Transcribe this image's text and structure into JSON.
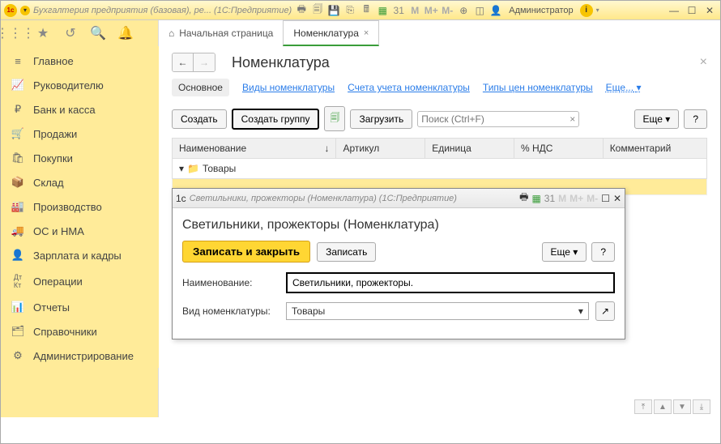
{
  "titlebar": {
    "title": "Бухгалтерия предприятия (базовая), ре... (1С:Предприятие)",
    "user_label": "Администратор",
    "m": "M",
    "mplus": "M+",
    "mminus": "M-"
  },
  "tabs": {
    "home": "Начальная страница",
    "active": "Номенклатура"
  },
  "sidebar": {
    "items": [
      {
        "label": "Главное"
      },
      {
        "label": "Руководителю"
      },
      {
        "label": "Банк и касса"
      },
      {
        "label": "Продажи"
      },
      {
        "label": "Покупки"
      },
      {
        "label": "Склад"
      },
      {
        "label": "Производство"
      },
      {
        "label": "ОС и НМА"
      },
      {
        "label": "Зарплата и кадры"
      },
      {
        "label": "Операции"
      },
      {
        "label": "Отчеты"
      },
      {
        "label": "Справочники"
      },
      {
        "label": "Администрирование"
      }
    ]
  },
  "page": {
    "title": "Номенклатура",
    "subtabs": {
      "main": "Основное",
      "types": "Виды номенклатуры",
      "accounts": "Счета учета номенклатуры",
      "price_types": "Типы цен номенклатуры",
      "more": "Еще..."
    },
    "cmdbar": {
      "create": "Создать",
      "create_group": "Создать группу",
      "load": "Загрузить",
      "search_placeholder": "Поиск (Ctrl+F)",
      "more": "Еще",
      "help": "?"
    },
    "grid": {
      "cols": {
        "name": "Наименование",
        "art": "Артикул",
        "unit": "Единица",
        "nds": "% НДС",
        "comm": "Комментарий"
      },
      "row_label": "Товары"
    }
  },
  "modal": {
    "title": "Светильники, прожекторы (Номенклатура) (1С:Предприятие)",
    "header": "Светильники, прожекторы (Номенклатура)",
    "m": "M",
    "mplus": "M+",
    "mminus": "M-",
    "cmdbar": {
      "save_close": "Записать и закрыть",
      "save": "Записать",
      "more": "Еще",
      "help": "?"
    },
    "form": {
      "name_label": "Наименование:",
      "name_value": "Светильники, прожекторы.",
      "type_label": "Вид номенклатуры:",
      "type_value": "Товары"
    }
  }
}
